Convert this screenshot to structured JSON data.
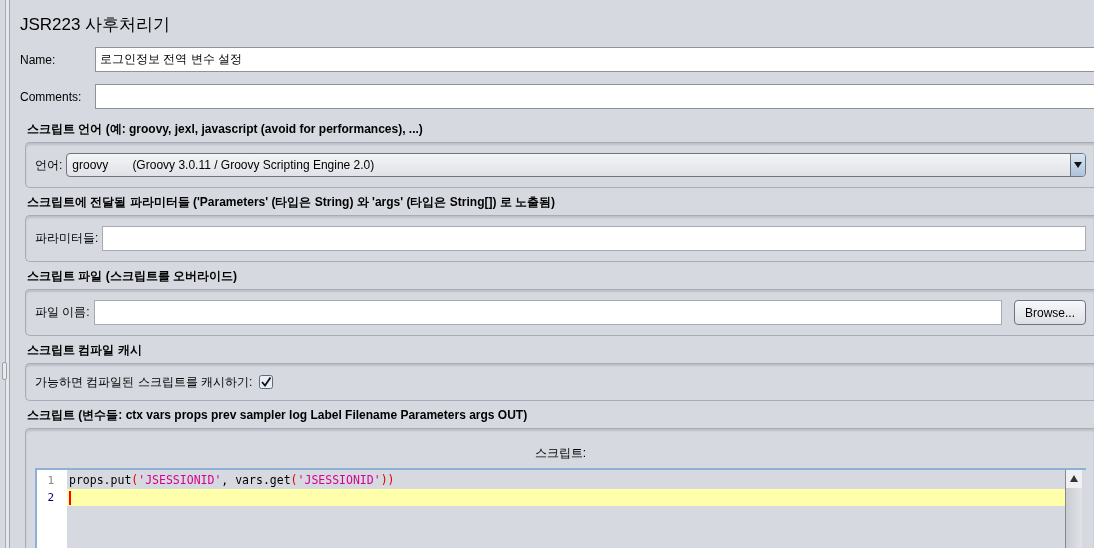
{
  "title": "JSR223 사후처리기",
  "name_field": {
    "label": "Name:",
    "value": "로그인정보 전역 변수 설정"
  },
  "comments_field": {
    "label": "Comments:"
  },
  "language_section": {
    "header": "스크립트 언어 (예: groovy, jexl, javascript (avoid for performances), ...)",
    "label": "언어:",
    "language": "groovy",
    "engine": "(Groovy 3.0.11 / Groovy Scripting Engine 2.0)"
  },
  "parameters_section": {
    "header": "스크립트에 전달될 파라미터들 ('Parameters' (타입은 String) 와 'args' (타입은 String[]) 로 노출됨)",
    "label": "파라미터들:"
  },
  "file_section": {
    "header": "스크립트 파일 (스크립트를 오버라이드)",
    "label": "파일 이름:",
    "button": "Browse..."
  },
  "cache_section": {
    "header": "스크립트 컴파일 캐시",
    "label": "가능하면 컴파일된 스크립트를 캐시하기:",
    "checked": true
  },
  "script_section": {
    "header": "스크립트 (변수들: ctx vars props prev sampler log Label Filename Parameters args OUT)",
    "caption": "스크립트:",
    "lines": [
      {
        "number": "1",
        "current": false,
        "tokens": [
          {
            "kind": "plain",
            "text": "props.put"
          },
          {
            "kind": "paren",
            "text": "("
          },
          {
            "kind": "string",
            "text": "'JSESSIONID'"
          },
          {
            "kind": "plain",
            "text": ", vars.get"
          },
          {
            "kind": "paren",
            "text": "("
          },
          {
            "kind": "string",
            "text": "'JSESSIONID'"
          },
          {
            "kind": "paren",
            "text": "))"
          }
        ]
      },
      {
        "number": "2",
        "current": true
      }
    ]
  }
}
